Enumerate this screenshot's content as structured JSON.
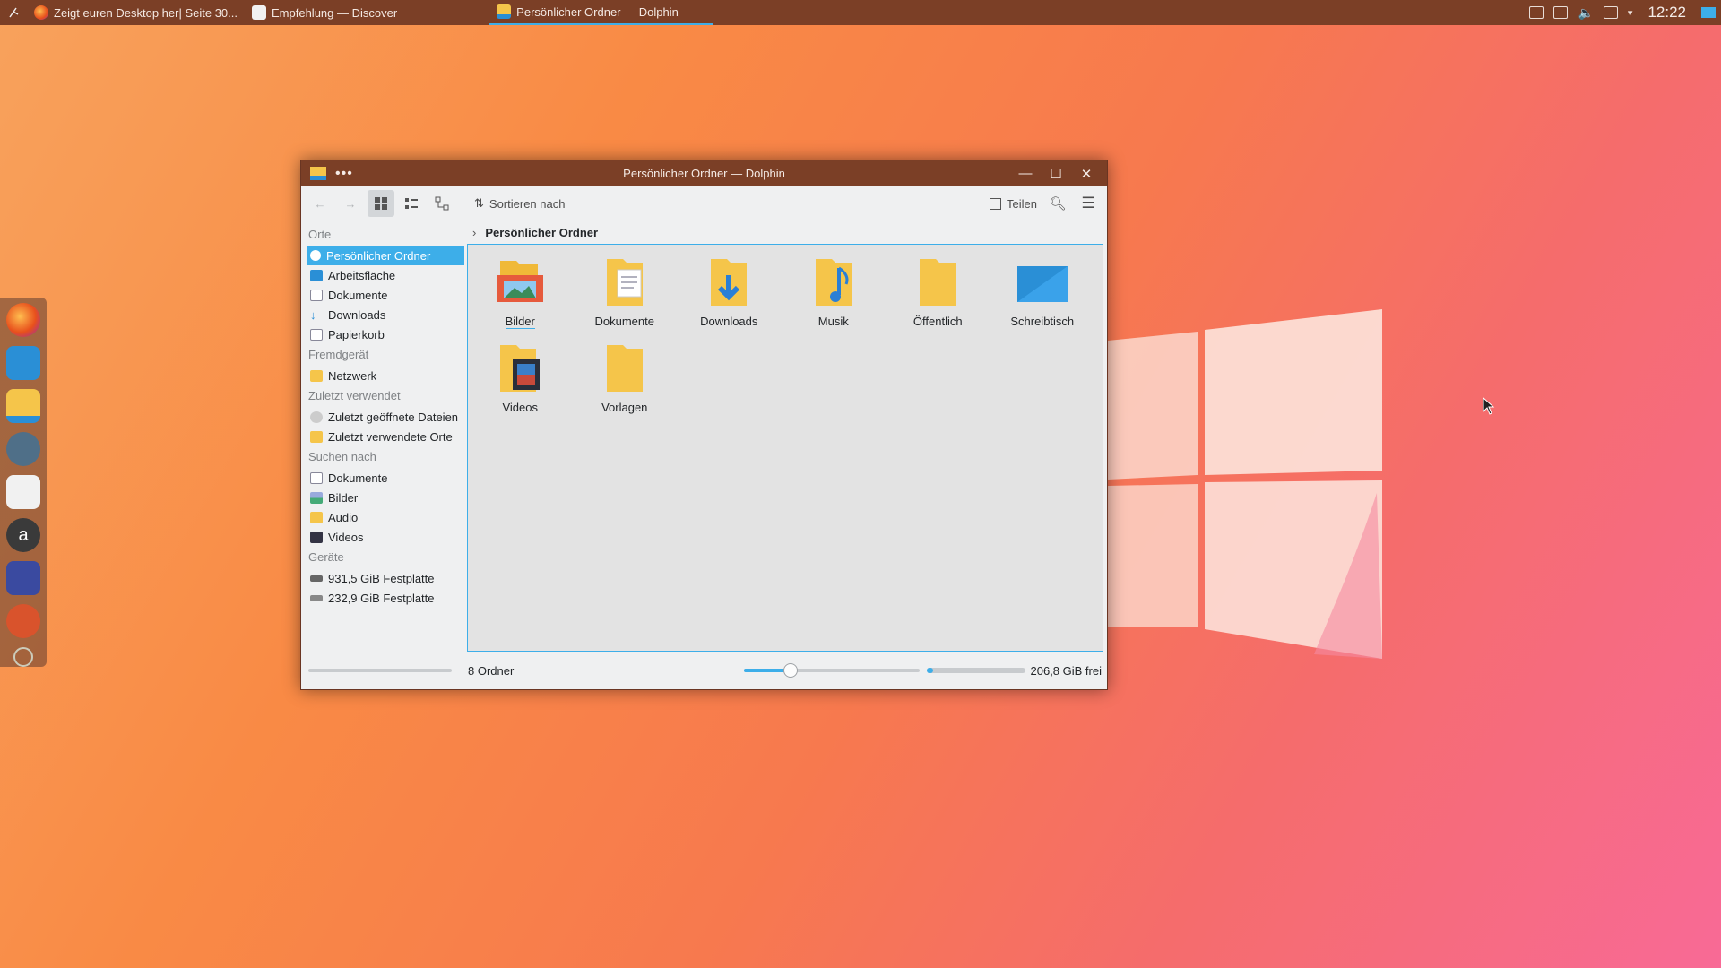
{
  "panel": {
    "tasks": [
      {
        "label": "Zeigt euren Desktop her| Seite 30...",
        "icon": "firefox-icon"
      },
      {
        "label": "Empfehlung — Discover",
        "icon": "discover-icon"
      },
      {
        "label": "Persönlicher Ordner — Dolphin",
        "icon": "dolphin-icon"
      }
    ],
    "clock": "12:22"
  },
  "window": {
    "title": "Persönlicher Ordner — Dolphin",
    "toolbar": {
      "sort_label": "Sortieren nach",
      "share_label": "Teilen"
    },
    "breadcrumb": "Persönlicher Ordner",
    "places": {
      "sections": [
        {
          "title": "Orte",
          "items": [
            {
              "label": "Persönlicher Ordner",
              "selected": true
            },
            {
              "label": "Arbeitsfläche"
            },
            {
              "label": "Dokumente"
            },
            {
              "label": "Downloads"
            },
            {
              "label": "Papierkorb"
            }
          ]
        },
        {
          "title": "Fremdgerät",
          "items": [
            {
              "label": "Netzwerk"
            }
          ]
        },
        {
          "title": "Zuletzt verwendet",
          "items": [
            {
              "label": "Zuletzt geöffnete Dateien"
            },
            {
              "label": "Zuletzt verwendete Orte"
            }
          ]
        },
        {
          "title": "Suchen nach",
          "items": [
            {
              "label": "Dokumente"
            },
            {
              "label": "Bilder"
            },
            {
              "label": "Audio"
            },
            {
              "label": "Videos"
            }
          ]
        },
        {
          "title": "Geräte",
          "items": [
            {
              "label": "931,5 GiB Festplatte"
            },
            {
              "label": "232,9 GiB Festplatte"
            }
          ]
        }
      ]
    },
    "folders": [
      {
        "label": "Bilder",
        "icon": "folder-pictures-icon"
      },
      {
        "label": "Dokumente",
        "icon": "folder-documents-icon"
      },
      {
        "label": "Downloads",
        "icon": "folder-downloads-icon"
      },
      {
        "label": "Musik",
        "icon": "folder-music-icon"
      },
      {
        "label": "Öffentlich",
        "icon": "folder-public-icon"
      },
      {
        "label": "Schreibtisch",
        "icon": "folder-desktop-icon"
      },
      {
        "label": "Videos",
        "icon": "folder-videos-icon"
      },
      {
        "label": "Vorlagen",
        "icon": "folder-templates-icon"
      }
    ],
    "status": {
      "count": "8 Ordner",
      "free": "206,8 GiB frei",
      "zoom_level_fraction": 0.27,
      "disk_used_fraction": 0.07
    }
  },
  "colors": {
    "accent": "#3daee9",
    "titlebar": "#7b3f26",
    "folder": "#f5c54a"
  }
}
